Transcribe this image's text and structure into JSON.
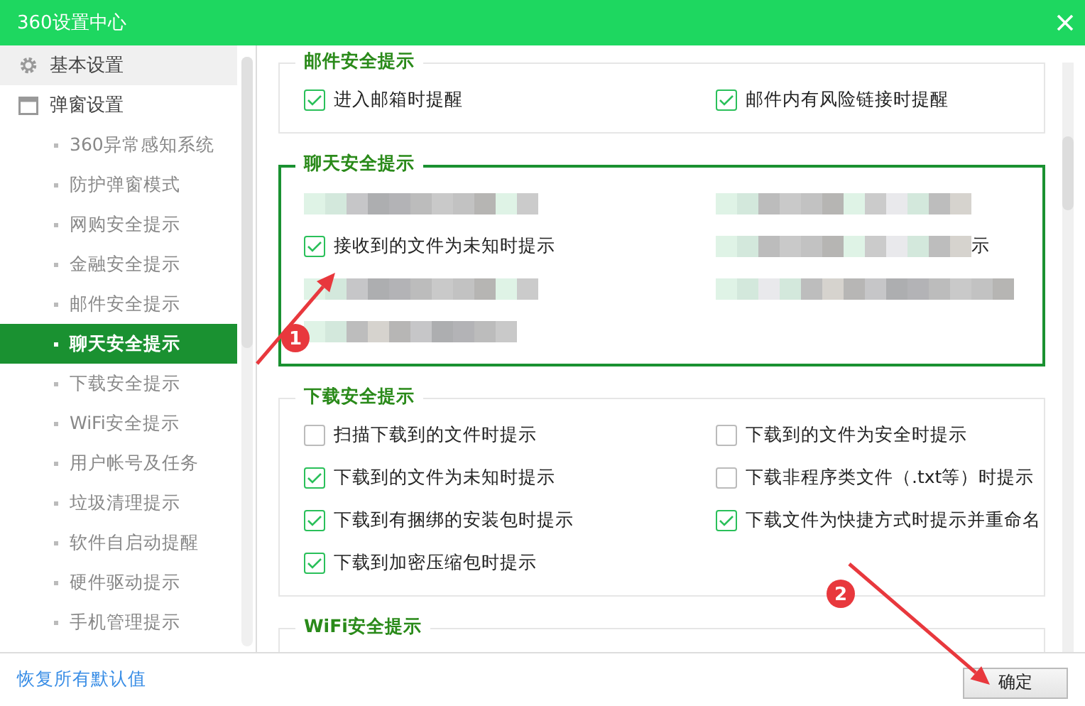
{
  "window": {
    "title": "360设置中心"
  },
  "sidebar": {
    "items": [
      {
        "kind": "category",
        "label": "基本设置",
        "hovered": true,
        "selected": false
      },
      {
        "kind": "category",
        "label": "弹窗设置",
        "hovered": false,
        "selected": false,
        "children": [
          {
            "label": "360异常感知系统",
            "selected": false
          },
          {
            "label": "防护弹窗模式",
            "selected": false
          },
          {
            "label": "网购安全提示",
            "selected": false
          },
          {
            "label": "金融安全提示",
            "selected": false
          },
          {
            "label": "邮件安全提示",
            "selected": false
          },
          {
            "label": "聊天安全提示",
            "selected": true
          },
          {
            "label": "下载安全提示",
            "selected": false
          },
          {
            "label": "WiFi安全提示",
            "selected": false
          },
          {
            "label": "用户帐号及任务",
            "selected": false
          },
          {
            "label": "垃圾清理提示",
            "selected": false
          },
          {
            "label": "软件自启动提醒",
            "selected": false
          },
          {
            "label": "硬件驱动提示",
            "selected": false
          },
          {
            "label": "手机管理提示",
            "selected": false
          }
        ]
      }
    ]
  },
  "sections": [
    {
      "title": "邮件安全提示",
      "focused": false,
      "items": [
        {
          "kind": "checkbox",
          "label": "进入邮箱时提醒",
          "checked": true
        },
        {
          "kind": "checkbox",
          "label": "邮件内有风险链接时提醒",
          "checked": true
        }
      ]
    },
    {
      "title": "聊天安全提示",
      "focused": true,
      "items": [
        {
          "kind": "blurred"
        },
        {
          "kind": "blurred"
        },
        {
          "kind": "checkbox",
          "label": "接收到的文件为未知时提示",
          "checked": true
        },
        {
          "kind": "blurred",
          "tail": "示"
        },
        {
          "kind": "blurred"
        },
        {
          "kind": "blurred"
        },
        {
          "kind": "blurred"
        }
      ]
    },
    {
      "title": "下载安全提示",
      "focused": false,
      "items": [
        {
          "kind": "checkbox",
          "label": "扫描下载到的文件时提示",
          "checked": false
        },
        {
          "kind": "checkbox",
          "label": "下载到的文件为安全时提示",
          "checked": false
        },
        {
          "kind": "checkbox",
          "label": "下载到的文件为未知时提示",
          "checked": true
        },
        {
          "kind": "checkbox",
          "label": "下载非程序类文件（.txt等）时提示",
          "checked": false
        },
        {
          "kind": "checkbox",
          "label": "下载到有捆绑的安装包时提示",
          "checked": true
        },
        {
          "kind": "checkbox",
          "label": "下载文件为快捷方式时提示并重命名",
          "checked": true
        },
        {
          "kind": "checkbox",
          "label": "下载到加密压缩包时提示",
          "checked": true
        }
      ]
    },
    {
      "title": "WiFi安全提示",
      "focused": false
    }
  ],
  "footer": {
    "link": "恢复所有默认值",
    "button": "确定"
  },
  "annotations": [
    {
      "label": "1"
    },
    {
      "label": "2"
    }
  ]
}
